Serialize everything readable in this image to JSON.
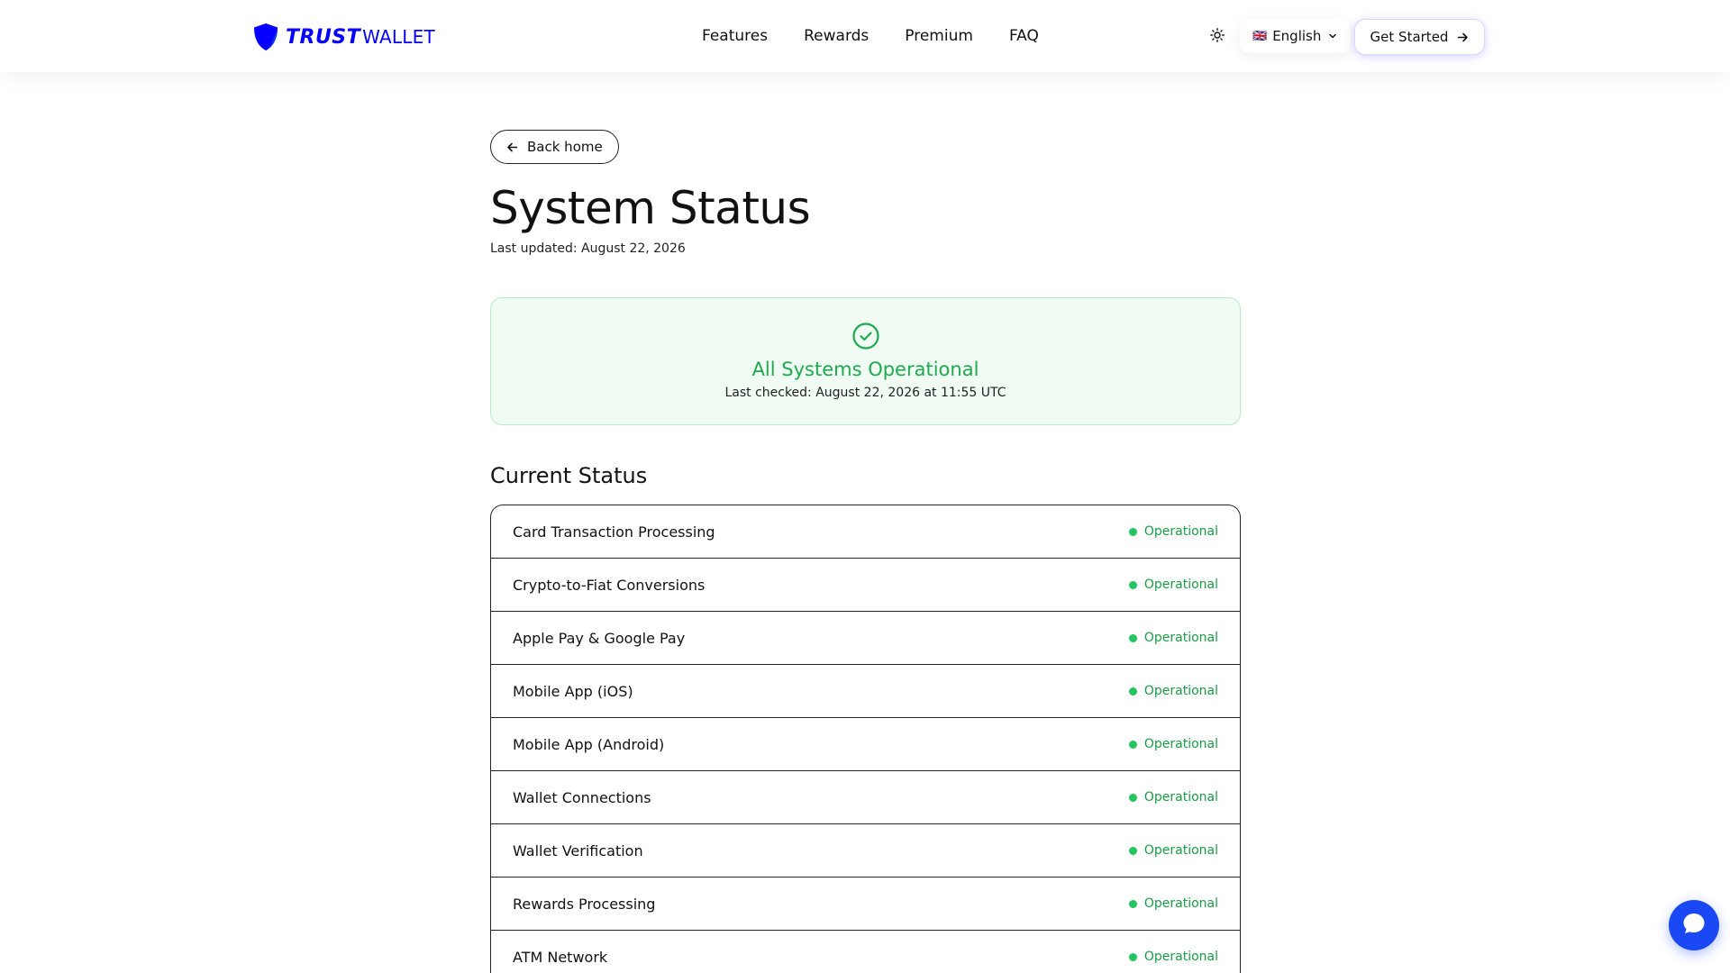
{
  "header": {
    "logo": {
      "brand_bold": "TRUST",
      "brand_light": "WALLET",
      "icon": "shield-icon",
      "color": "#0500FF"
    },
    "nav": [
      {
        "label": "Features"
      },
      {
        "label": "Rewards"
      },
      {
        "label": "Premium"
      },
      {
        "label": "FAQ"
      }
    ],
    "theme_toggle_icon": "sun-icon",
    "language": {
      "flag": "🇬🇧",
      "label": "English",
      "icon": "chevron-down-icon"
    },
    "get_started": {
      "label": "Get Started",
      "icon": "arrow-right-icon"
    }
  },
  "main": {
    "back": {
      "label": "Back home",
      "icon": "arrow-left-icon"
    },
    "title": "System Status",
    "last_updated": "Last updated: August 22, 2026",
    "banner": {
      "icon": "check-circle-icon",
      "title": "All Systems Operational",
      "subtitle": "Last checked: August 22, 2026 at 11:55 UTC",
      "color": "#1faa4f"
    },
    "current_status_heading": "Current Status",
    "services": [
      {
        "name": "Card Transaction Processing",
        "status": "Operational"
      },
      {
        "name": "Crypto-to-Fiat Conversions",
        "status": "Operational"
      },
      {
        "name": "Apple Pay & Google Pay",
        "status": "Operational"
      },
      {
        "name": "Mobile App (iOS)",
        "status": "Operational"
      },
      {
        "name": "Mobile App (Android)",
        "status": "Operational"
      },
      {
        "name": "Wallet Connections",
        "status": "Operational"
      },
      {
        "name": "Wallet Verification",
        "status": "Operational"
      },
      {
        "name": "Rewards Processing",
        "status": "Operational"
      },
      {
        "name": "ATM Network",
        "status": "Operational"
      }
    ],
    "status_color": "#22c55e"
  },
  "chat": {
    "icon": "chat-bubble-icon",
    "color": "#1b48f5"
  }
}
